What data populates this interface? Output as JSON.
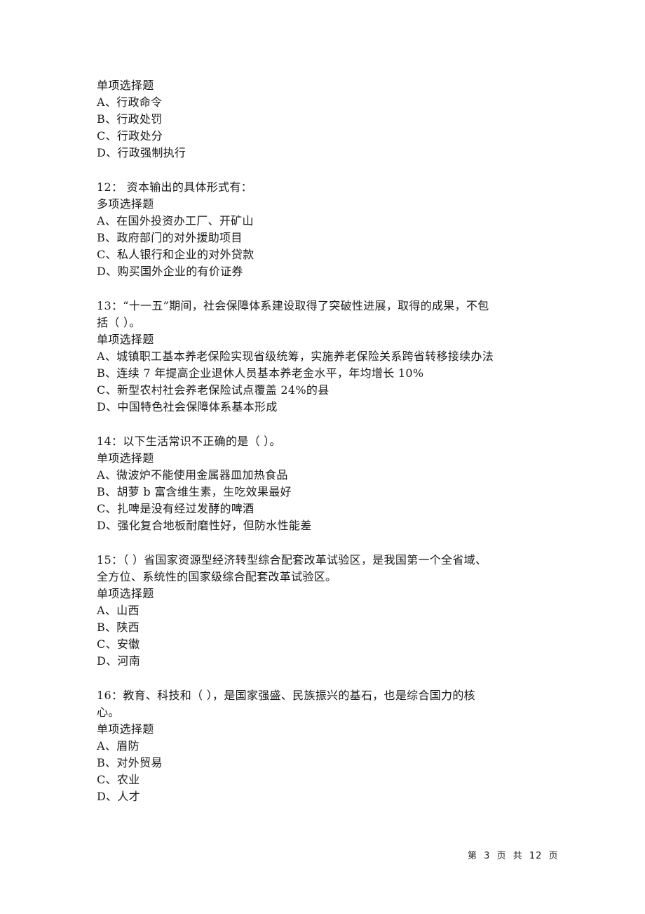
{
  "partial_question": {
    "type": "单项选择题",
    "options": [
      "A、行政命令",
      "B、行政处罚",
      "C、行政处分",
      "D、行政强制执行"
    ]
  },
  "questions": [
    {
      "stem_lines": [
        "12：  资本输出的具体形式有："
      ],
      "type": "多项选择题",
      "options": [
        "A、在国外投资办工厂、开矿山",
        "B、政府部门的对外援助项目",
        "C、私人银行和企业的对外贷款",
        "D、购买国外企业的有价证券"
      ]
    },
    {
      "stem_lines": [
        "13：“十一五”期间，社会保障体系建设取得了突破性进展，取得的成果，不包",
        "括（    ）。"
      ],
      "type": "单项选择题",
      "options": [
        "A、城镇职工基本养老保险实现省级统筹，实施养老保险关系跨省转移接续办法",
        "B、连续 7 年提高企业退休人员基本养老金水平，年均增长 10%",
        "C、新型农村社会养老保险试点覆盖 24%的县",
        "D、中国特色社会保障体系基本形成"
      ]
    },
    {
      "stem_lines": [
        "14：以下生活常识不正确的是（    ）。"
      ],
      "type": "单项选择题",
      "options": [
        "A、微波炉不能使用金属器皿加热食品",
        "B、胡萝 b 富含维生素，生吃效果最好",
        "C、扎啤是没有经过发酵的啤酒",
        "D、强化复合地板耐磨性好，但防水性能差"
      ]
    },
    {
      "stem_lines": [
        "15：（    ）省国家资源型经济转型综合配套改革试验区，是我国第一个全省域、",
        "全方位、系统性的国家级综合配套改革试验区。"
      ],
      "type": "单项选择题",
      "options": [
        "A、山西",
        "B、陕西",
        "C、安徽",
        "D、河南"
      ]
    },
    {
      "stem_lines": [
        "16：教育、科技和（    ），是国家强盛、民族振兴的基石，也是综合国力的核",
        "心。"
      ],
      "type": "单项选择题",
      "options": [
        "A、眉防",
        "B、对外贸易",
        "C、农业",
        "D、人才"
      ]
    }
  ],
  "footer": {
    "prefix": "第",
    "current_page": "3",
    "mid1": "页",
    "mid2": "共",
    "total_pages": "12",
    "suffix": "页"
  }
}
